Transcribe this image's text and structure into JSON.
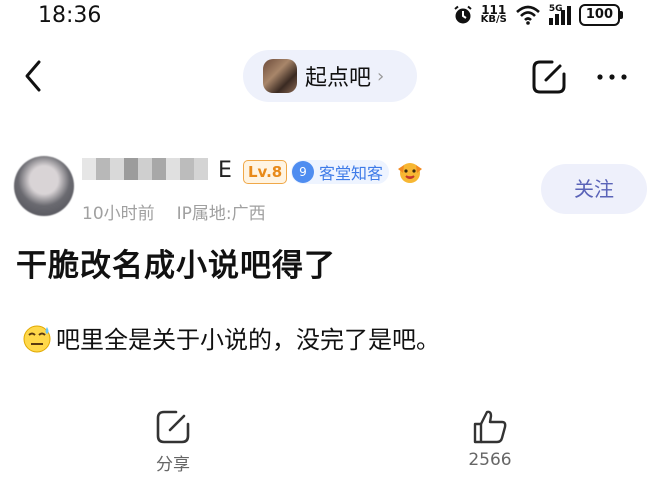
{
  "status_bar": {
    "time": "18:36",
    "net_speed_value": "111",
    "net_speed_unit": "KB/S",
    "signal_label": "5G",
    "battery": "100"
  },
  "nav": {
    "bar_name": "起点吧",
    "chevron": "›"
  },
  "post": {
    "author_name_visible": "E",
    "level": "Lv.8",
    "tag_number": "9",
    "tag_text": "客堂知客",
    "time_ago": "10小时前",
    "ip_location": "IP属地:广西",
    "follow_label": "关注",
    "title": "干脆改名成小说吧得了",
    "body": "吧里全是关于小说的，没完了是吧。"
  },
  "actions": {
    "share_label": "分享",
    "like_count": "2566"
  },
  "icons": [
    "alarm-icon",
    "wifi-icon",
    "signal-icon",
    "battery-icon",
    "back-icon",
    "chevron-right-icon",
    "edit-icon",
    "more-icon",
    "emoji-badge-icon",
    "sweat-face-icon",
    "share-icon",
    "thumbs-up-icon"
  ],
  "colors": {
    "follow_text": "#5a63b8",
    "level_badge": "#e88a1a",
    "tag_badge": "#3e7be8",
    "chip_bg": "#eef1fb"
  }
}
